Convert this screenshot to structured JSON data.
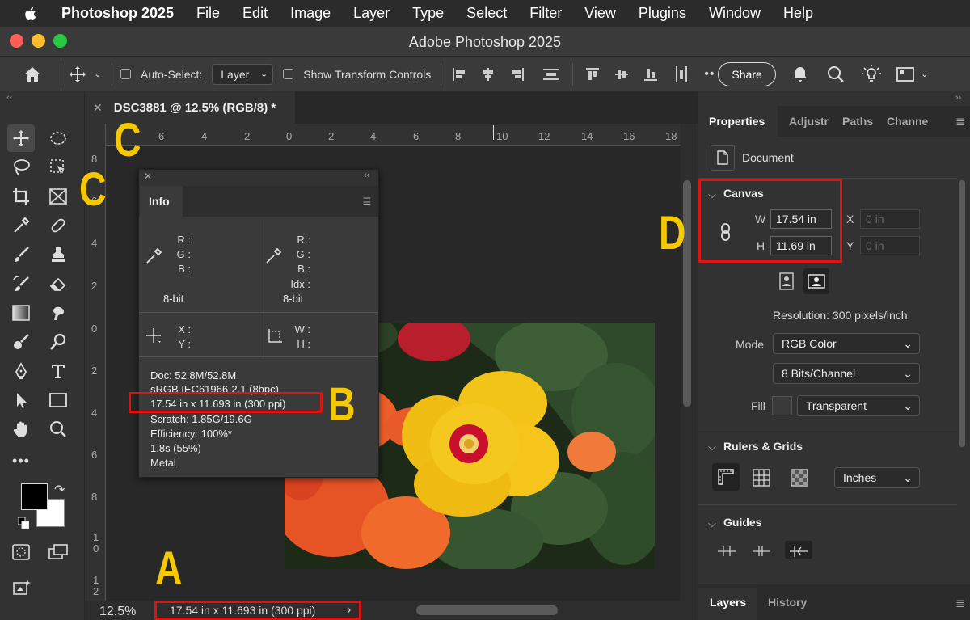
{
  "menubar": {
    "app_name": "Photoshop 2025",
    "items": [
      "File",
      "Edit",
      "Image",
      "Layer",
      "Type",
      "Select",
      "Filter",
      "View",
      "Plugins",
      "Window",
      "Help"
    ]
  },
  "window": {
    "title": "Adobe Photoshop 2025"
  },
  "options_bar": {
    "auto_select_label": "Auto-Select:",
    "auto_select_value": "Layer",
    "show_transform_label": "Show Transform Controls",
    "more_label": "••",
    "share_label": "Share"
  },
  "document": {
    "tab_title": "DSC3881 @ 12.5% (RGB/8) *",
    "zoom": "12.5%",
    "status_text": "17.54 in x 11.693 in (300 ppi)",
    "status_arrow": "›"
  },
  "rulers": {
    "horizontal": [
      "6",
      "4",
      "2",
      "0",
      "2",
      "4",
      "6",
      "8",
      "10",
      "12",
      "14",
      "16",
      "18"
    ],
    "vertical": [
      "8",
      "6",
      "4",
      "2",
      "0",
      "2",
      "4",
      "6",
      "8",
      "1\n0",
      "1\n2"
    ]
  },
  "info_panel": {
    "tab": "Info",
    "color1_labels": [
      "R :",
      "G :",
      "B :"
    ],
    "color1_bit": "8-bit",
    "color2_labels": [
      "R :",
      "G :",
      "B :",
      "Idx :"
    ],
    "color2_bit": "8-bit",
    "xy_labels": [
      "X :",
      "Y :"
    ],
    "wh_labels": [
      "W :",
      "H :"
    ],
    "lines": [
      "Doc: 52.8M/52.8M",
      "sRGB IEC61966-2.1 (8bpc)",
      "17.54 in x 11.693 in (300 ppi)",
      "Scratch: 1.85G/19.6G",
      "Efficiency: 100%*",
      "1.8s (55%)",
      "Metal"
    ]
  },
  "properties": {
    "tabs": [
      "Properties",
      "Adjustr",
      "Paths",
      "Channe"
    ],
    "document_label": "Document",
    "canvas_section": "Canvas",
    "w_label": "W",
    "w_value": "17.54 in",
    "h_label": "H",
    "h_value": "11.69 in",
    "x_label": "X",
    "x_value": "0 in",
    "y_label": "Y",
    "y_value": "0 in",
    "resolution": "Resolution: 300 pixels/inch",
    "mode_label": "Mode",
    "mode_value": "RGB Color",
    "bits_value": "8 Bits/Channel",
    "fill_label": "Fill",
    "fill_value": "Transparent",
    "rulers_section": "Rulers & Grids",
    "units_value": "Inches",
    "guides_section": "Guides"
  },
  "bottom_tabs": [
    "Layers",
    "History"
  ],
  "annotations": {
    "a": "A",
    "b": "B",
    "c1": "C",
    "c2": "C",
    "d": "D"
  },
  "colors": {
    "highlight": "#e01212",
    "annotation": "#f5c800",
    "menubar": "#2b2b2b",
    "panel": "#323232"
  }
}
